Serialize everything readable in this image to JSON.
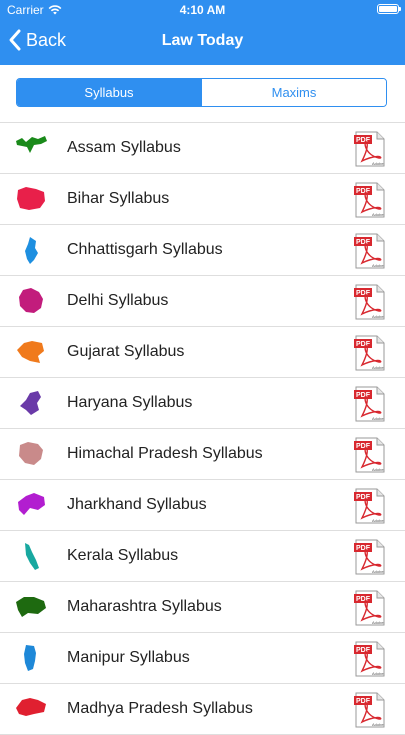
{
  "status_bar": {
    "carrier": "Carrier",
    "time": "4:10 AM"
  },
  "nav": {
    "back_label": "Back",
    "title": "Law Today"
  },
  "segments": [
    {
      "label": "Syllabus",
      "active": true
    },
    {
      "label": "Maxims",
      "active": false
    }
  ],
  "colors": {
    "accent": "#2f8ff0",
    "pdf_red": "#d8282f"
  },
  "items": [
    {
      "label": "Assam Syllabus",
      "color": "#1a8a1a",
      "icon": "assam-map-icon"
    },
    {
      "label": "Bihar Syllabus",
      "color": "#e8204a",
      "icon": "bihar-map-icon"
    },
    {
      "label": "Chhattisgarh Syllabus",
      "color": "#1e8fe0",
      "icon": "chhattisgarh-map-icon"
    },
    {
      "label": "Delhi Syllabus",
      "color": "#c21c7c",
      "icon": "delhi-map-icon"
    },
    {
      "label": "Gujarat Syllabus",
      "color": "#f07a1c",
      "icon": "gujarat-map-icon"
    },
    {
      "label": "Haryana Syllabus",
      "color": "#6a3aa8",
      "icon": "haryana-map-icon"
    },
    {
      "label": "Himachal Pradesh Syllabus",
      "color": "#c98a8a",
      "icon": "himachal-pradesh-map-icon"
    },
    {
      "label": "Jharkhand Syllabus",
      "color": "#b21ed0",
      "icon": "jharkhand-map-icon"
    },
    {
      "label": "Kerala Syllabus",
      "color": "#18a8a0",
      "icon": "kerala-map-icon"
    },
    {
      "label": "Maharashtra Syllabus",
      "color": "#1e6a10",
      "icon": "maharashtra-map-icon"
    },
    {
      "label": "Manipur Syllabus",
      "color": "#1e88d8",
      "icon": "manipur-map-icon"
    },
    {
      "label": "Madhya Pradesh Syllabus",
      "color": "#e02030",
      "icon": "madhya-pradesh-map-icon"
    }
  ]
}
